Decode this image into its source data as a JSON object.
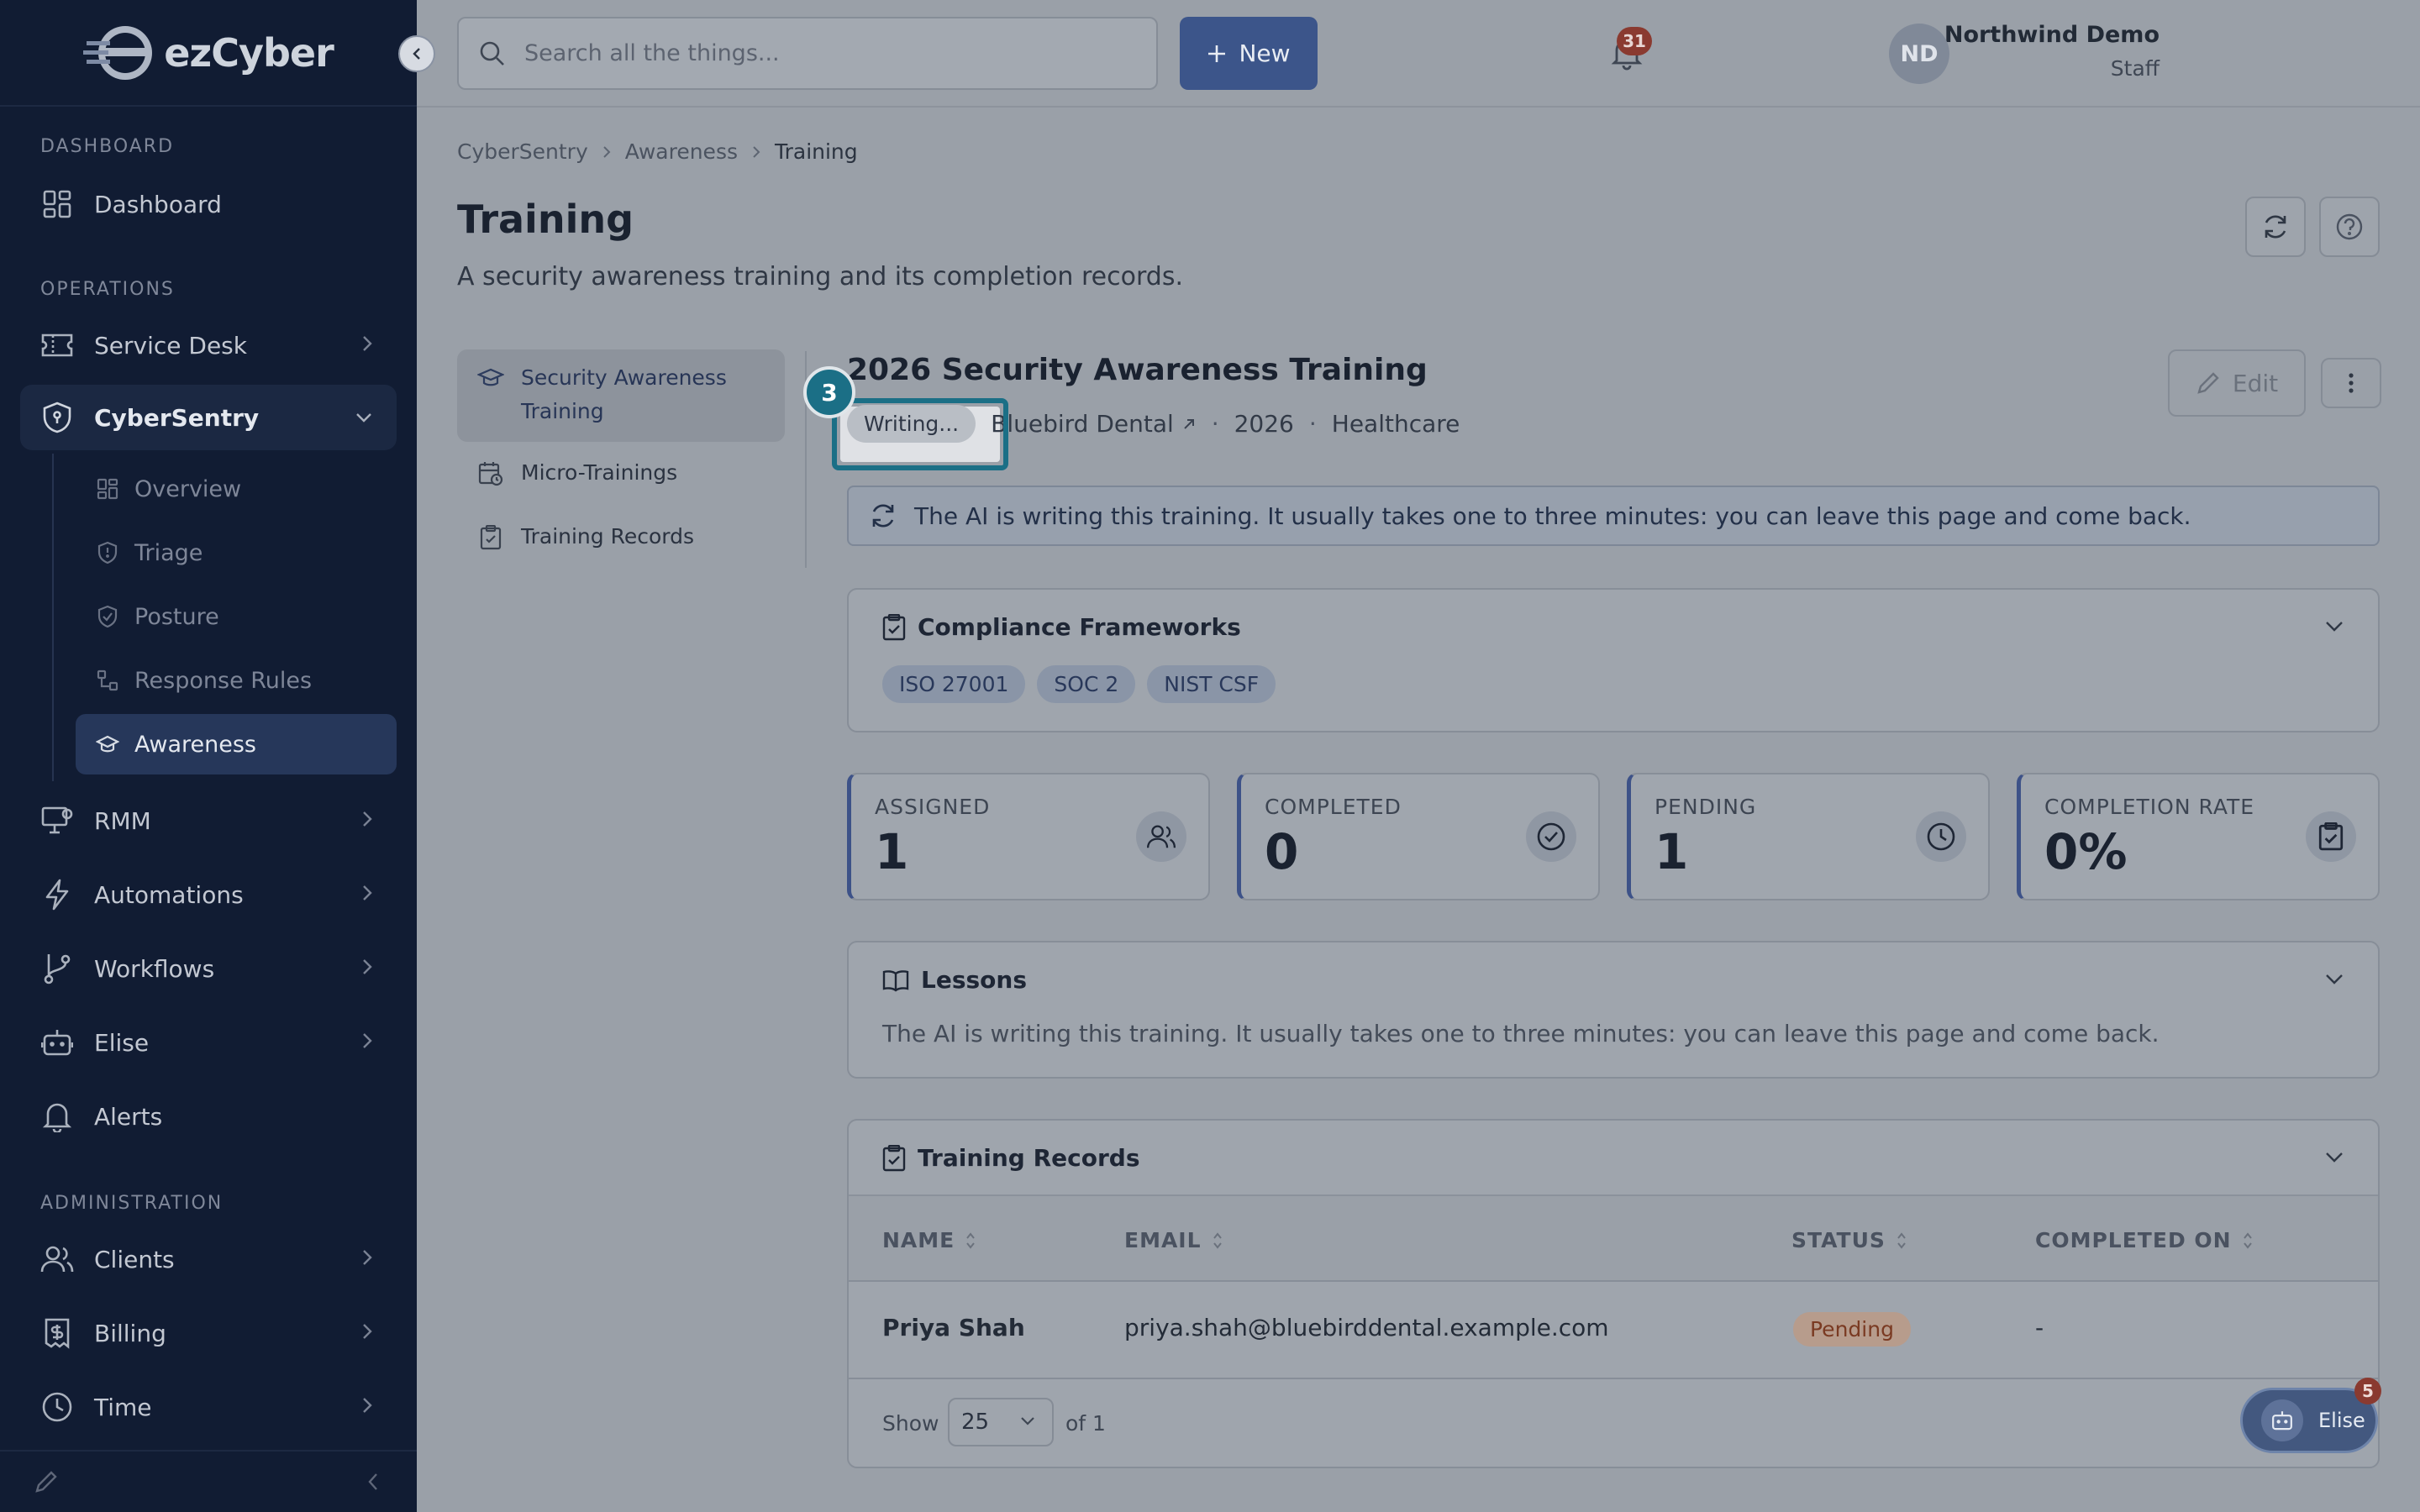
{
  "app": {
    "brand": "ezCyber"
  },
  "sidebar": {
    "sections": {
      "dashboard": "DASHBOARD",
      "operations": "OPERATIONS",
      "administration": "ADMINISTRATION"
    },
    "items": {
      "dashboard": "Dashboard",
      "service_desk": "Service Desk",
      "cybersentry": "CyberSentry",
      "rmm": "RMM",
      "automations": "Automations",
      "workflows": "Workflows",
      "elise": "Elise",
      "alerts": "Alerts",
      "clients": "Clients",
      "billing": "Billing",
      "time": "Time"
    },
    "cybersentry_sub": {
      "overview": "Overview",
      "triage": "Triage",
      "posture": "Posture",
      "response_rules": "Response Rules",
      "awareness": "Awareness"
    }
  },
  "topbar": {
    "search_placeholder": "Search all the things...",
    "new_label": "New",
    "notification_count": "31",
    "user_name": "Northwind Demo",
    "user_role": "Staff",
    "avatar_initials": "ND"
  },
  "breadcrumb": [
    "CyberSentry",
    "Awareness",
    "Training"
  ],
  "page": {
    "title": "Training",
    "subtitle": "A security awareness training and its completion records."
  },
  "subnav": {
    "security_awareness_line1": "Security Awareness",
    "security_awareness_line2": "Training",
    "micro_trainings": "Micro-Trainings",
    "training_records": "Training Records"
  },
  "training": {
    "title": "2026 Security Awareness Training",
    "status": "Writing...",
    "client": "Bluebird Dental",
    "year": "2026",
    "industry": "Healthcare",
    "edit_label": "Edit",
    "step_number": "3",
    "notice": "The AI is writing this training. It usually takes one to three minutes: you can leave this page and come back."
  },
  "compliance": {
    "title": "Compliance Frameworks",
    "frameworks": [
      "ISO 27001",
      "SOC 2",
      "NIST CSF"
    ]
  },
  "stats": [
    {
      "label": "ASSIGNED",
      "value": "1",
      "icon": "users-icon"
    },
    {
      "label": "COMPLETED",
      "value": "0",
      "icon": "check-circle-icon"
    },
    {
      "label": "PENDING",
      "value": "1",
      "icon": "clock-icon"
    },
    {
      "label": "COMPLETION RATE",
      "value": "0%",
      "icon": "clipboard-check-icon"
    }
  ],
  "lessons": {
    "title": "Lessons",
    "text": "The AI is writing this training. It usually takes one to three minutes: you can leave this page and come back."
  },
  "records": {
    "title": "Training Records",
    "columns": [
      "NAME",
      "EMAIL",
      "STATUS",
      "COMPLETED ON"
    ],
    "rows": [
      {
        "name": "Priya Shah",
        "email": "priya.shah@bluebirddental.example.com",
        "status": "Pending",
        "completed_on": "-"
      }
    ],
    "show_label": "Show",
    "page_size": "25",
    "of_label": "of 1"
  },
  "assistant": {
    "label": "Elise",
    "badge": "5"
  },
  "colors": {
    "sidebar": "#111c33",
    "accent": "#3c558a",
    "highlight": "#1b6f86",
    "pending": "#7a3a22"
  }
}
